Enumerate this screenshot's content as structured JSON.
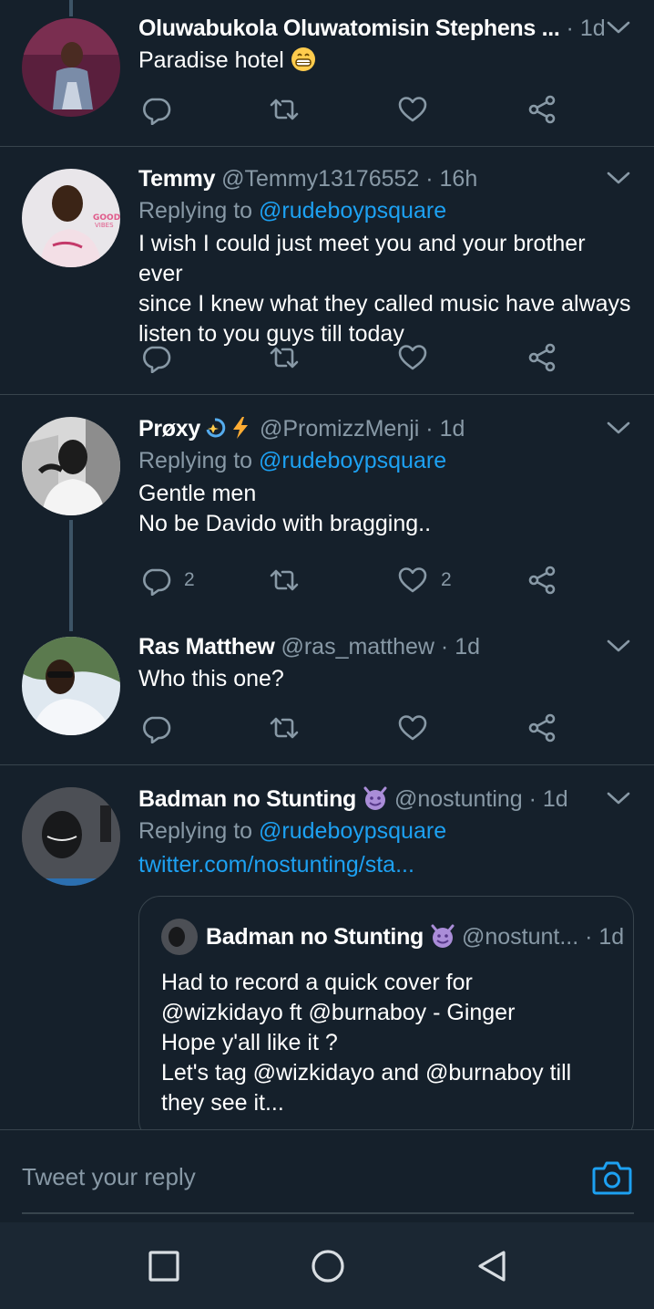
{
  "tweets": [
    {
      "name": "Oluwabukola Oluwatomisin Stephens ...",
      "handle": "",
      "time": "1d",
      "text": "Paradise hotel",
      "reply_count": "",
      "like_count": ""
    },
    {
      "name": "Temmy",
      "handle": "@Temmy13176552",
      "time": "16h",
      "replying_prefix": "Replying to",
      "replying_to": "@rudeboypsquare",
      "text_lines": [
        "I wish I could just meet you and your brother ever",
        "since I knew what they called music have always",
        "listen to you guys till today"
      ]
    },
    {
      "name": "Prøxy",
      "handle": "@PromizzMenji",
      "time": "1d",
      "replying_prefix": "Replying to",
      "replying_to": "@rudeboypsquare",
      "text_lines": [
        "Gentle men",
        "No be Davido with bragging.."
      ],
      "reply_count": "2",
      "like_count": "2"
    },
    {
      "name": "Ras Matthew",
      "handle": "@ras_matthew",
      "time": "1d",
      "text": "Who this one?"
    },
    {
      "name": "Badman no Stunting",
      "handle": "@nostunting",
      "time": "1d",
      "replying_prefix": "Replying to",
      "replying_to": "@rudeboypsquare",
      "link": "twitter.com/nostunting/sta...",
      "quote": {
        "name": "Badman no Stunting",
        "handle": "@nostunt...",
        "time": "1d",
        "text_lines": [
          "Had to record a quick cover for",
          "@wizkidayo ft @burnaboy - Ginger",
          "Hope y'all like it ?",
          "Let's tag @wizkidayo and @burnaboy  till",
          "they see it..."
        ]
      }
    }
  ],
  "composer": {
    "placeholder": "Tweet your reply"
  },
  "icons": {
    "reply": "reply-icon",
    "retweet": "retweet-icon",
    "like": "heart-icon",
    "share": "share-icon",
    "caret": "chevron-down-icon",
    "camera": "camera-icon"
  },
  "colors": {
    "background": "#15202b",
    "divider": "#38444d",
    "muted": "#8899a6",
    "accent": "#1da1f2",
    "navbar": "#1b2733"
  }
}
